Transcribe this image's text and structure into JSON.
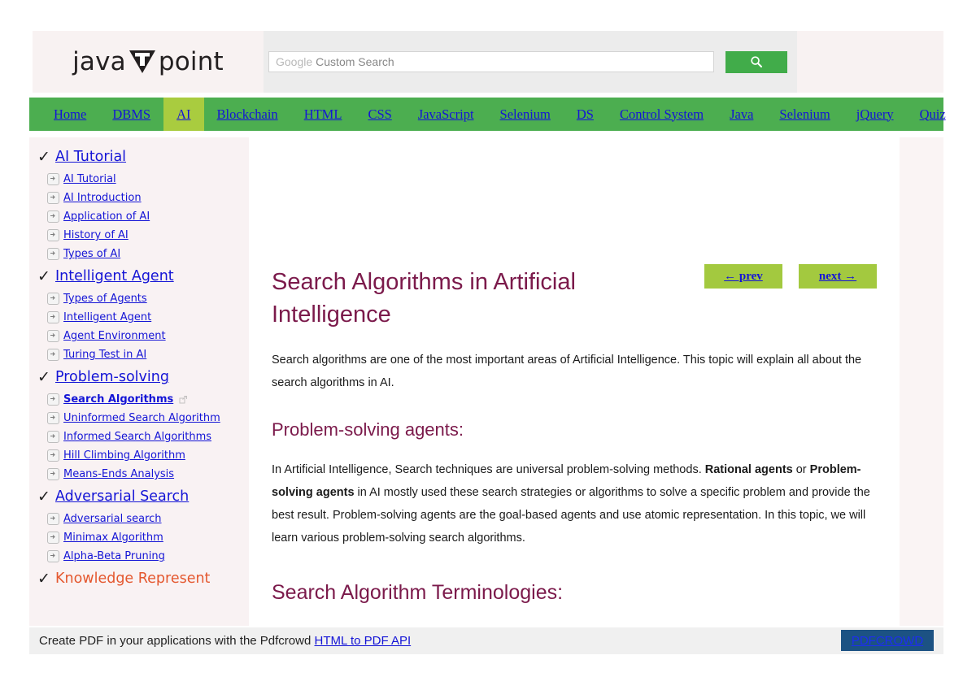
{
  "header": {
    "logo": {
      "left_text": "java",
      "right_text": "point",
      "mark": "triangle-t-mark"
    },
    "search": {
      "google_label": "Google",
      "placeholder_rest": "Custom Search",
      "value": "",
      "button_icon": "search-icon"
    }
  },
  "nav": {
    "items": [
      {
        "label": "Home",
        "active": false
      },
      {
        "label": "DBMS",
        "active": false
      },
      {
        "label": "AI",
        "active": true
      },
      {
        "label": "Blockchain",
        "active": false
      },
      {
        "label": "HTML",
        "active": false
      },
      {
        "label": "CSS",
        "active": false
      },
      {
        "label": "JavaScript",
        "active": false
      },
      {
        "label": "Selenium",
        "active": false
      },
      {
        "label": "DS",
        "active": false
      },
      {
        "label": "Control System",
        "active": false
      },
      {
        "label": "Java",
        "active": false
      },
      {
        "label": "Selenium",
        "active": false
      },
      {
        "label": "jQuery",
        "active": false
      },
      {
        "label": "Quiz",
        "active": false
      }
    ]
  },
  "sidebar": {
    "groups": [
      {
        "label": "AI Tutorial",
        "icon": "check-icon",
        "style": "link",
        "items": [
          {
            "label": "AI Tutorial",
            "current": false
          },
          {
            "label": "AI Introduction",
            "current": false
          },
          {
            "label": "Application of AI",
            "current": false
          },
          {
            "label": "History of AI",
            "current": false
          },
          {
            "label": "Types of AI",
            "current": false
          }
        ]
      },
      {
        "label": "Intelligent Agent",
        "icon": "check-icon",
        "style": "link",
        "items": [
          {
            "label": "Types of Agents",
            "current": false
          },
          {
            "label": "Intelligent Agent",
            "current": false
          },
          {
            "label": "Agent Environment",
            "current": false
          },
          {
            "label": "Turing Test in AI",
            "current": false
          }
        ]
      },
      {
        "label": "Problem-solving",
        "icon": "check-icon",
        "style": "link",
        "items": [
          {
            "label": "Search Algorithms",
            "current": true
          },
          {
            "label": "Uninformed Search Algorithm",
            "current": false
          },
          {
            "label": "Informed Search Algorithms",
            "current": false
          },
          {
            "label": "Hill Climbing Algorithm",
            "current": false
          },
          {
            "label": "Means-Ends Analysis",
            "current": false
          }
        ]
      },
      {
        "label": "Adversarial Search",
        "icon": "check-icon",
        "style": "link",
        "items": [
          {
            "label": "Adversarial search",
            "current": false
          },
          {
            "label": "Minimax Algorithm",
            "current": false
          },
          {
            "label": "Alpha-Beta Pruning",
            "current": false
          }
        ]
      },
      {
        "label": "Knowledge Represent",
        "icon": "check-icon",
        "style": "plain",
        "items": []
      }
    ]
  },
  "article": {
    "title": "Search Algorithms in Artificial Intelligence",
    "prev_button": "← prev",
    "next_button": "next →",
    "intro": "Search algorithms are one of the most important areas of Artificial Intelligence. This topic will explain all about the search algorithms in AI.",
    "heading_agents": "Problem-solving agents:",
    "paragraph_1_part1": "In Artificial Intelligence, Search techniques are universal problem-solving methods. ",
    "paragraph_1_bold1": "Rational agents",
    "paragraph_1_part2": " or ",
    "paragraph_1_bold2": "Problem-solving agents",
    "paragraph_1_part3": " in AI mostly used these search strategies or algorithms to solve a specific problem and provide the best result. Problem-solving agents are the goal-based agents and use atomic representation. In this topic, we will learn various problem-solving search algorithms.",
    "heading_terminologies": "Search Algorithm Terminologies:"
  },
  "footer": {
    "text_before_link": "Create PDF in your applications with the Pdfcrowd ",
    "link_label": "HTML to PDF API",
    "badge_label": "PDFCROWD"
  },
  "colors": {
    "nav_green": "#4cae50",
    "nav_active": "#a9cc3f",
    "heading_maroon": "#7b1a4b",
    "link_blue": "#1414d6",
    "accent_orange": "#e4572e",
    "button_green": "#a3c93f",
    "search_green": "#41ac4a",
    "badge_blue": "#1c5283"
  }
}
